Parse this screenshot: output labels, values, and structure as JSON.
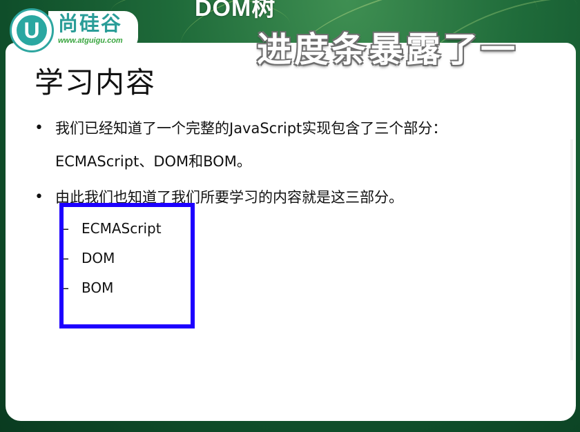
{
  "header": {
    "top_title": "DOM树",
    "subtitle_overlay": "进度条暴露了一"
  },
  "logo": {
    "letter": "U",
    "brand": "尚硅谷",
    "url": "www.atguigu.com"
  },
  "slide": {
    "heading": "学习内容",
    "bullets": [
      {
        "marker": "•",
        "lines": [
          "我们已经知道了一个完整的JavaScript实现包含了三个部分：",
          "ECMAScript、DOM和BOM。"
        ]
      },
      {
        "marker": "•",
        "lines": [
          "由此我们也知道了我们所要学习的内容就是这三部分。"
        ]
      }
    ],
    "sub_items": [
      {
        "marker": "–",
        "label": "ECMAScript"
      },
      {
        "marker": "–",
        "label": "DOM"
      },
      {
        "marker": "–",
        "label": "BOM"
      }
    ]
  },
  "colors": {
    "background_green": "#1f6b3a",
    "logo_teal": "#2aa7a1",
    "highlight_box": "#1d00ff",
    "text": "#111111"
  }
}
